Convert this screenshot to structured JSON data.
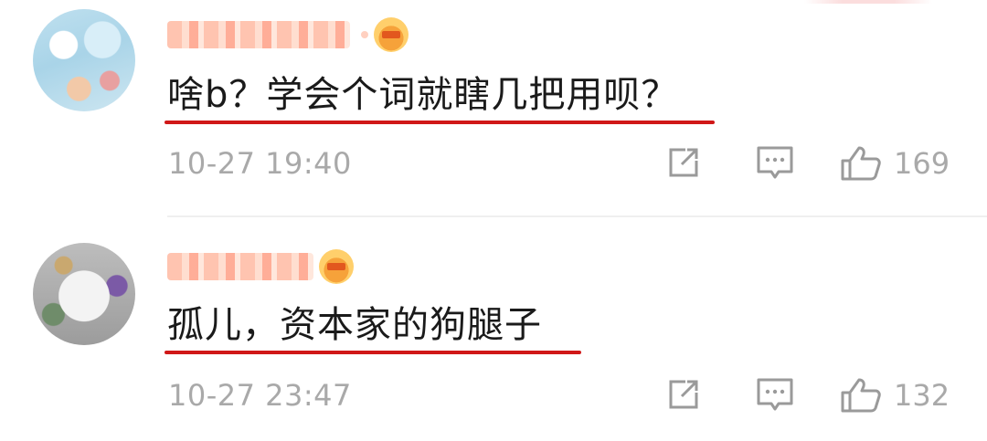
{
  "comments": [
    {
      "text": "啥b？学会个词就瞎几把用呗？",
      "time": "10-27 19:40",
      "likes": "169",
      "colors": {
        "underline": "#d01818",
        "meta": "#a9a9a9"
      },
      "icons": [
        "share-icon",
        "reply-icon",
        "like-icon"
      ]
    },
    {
      "text": "孤儿，资本家的狗腿子",
      "time": "10-27 23:47",
      "likes": "132",
      "colors": {
        "underline": "#d01818",
        "meta": "#a9a9a9"
      },
      "icons": [
        "share-icon",
        "reply-icon",
        "like-icon"
      ]
    }
  ]
}
